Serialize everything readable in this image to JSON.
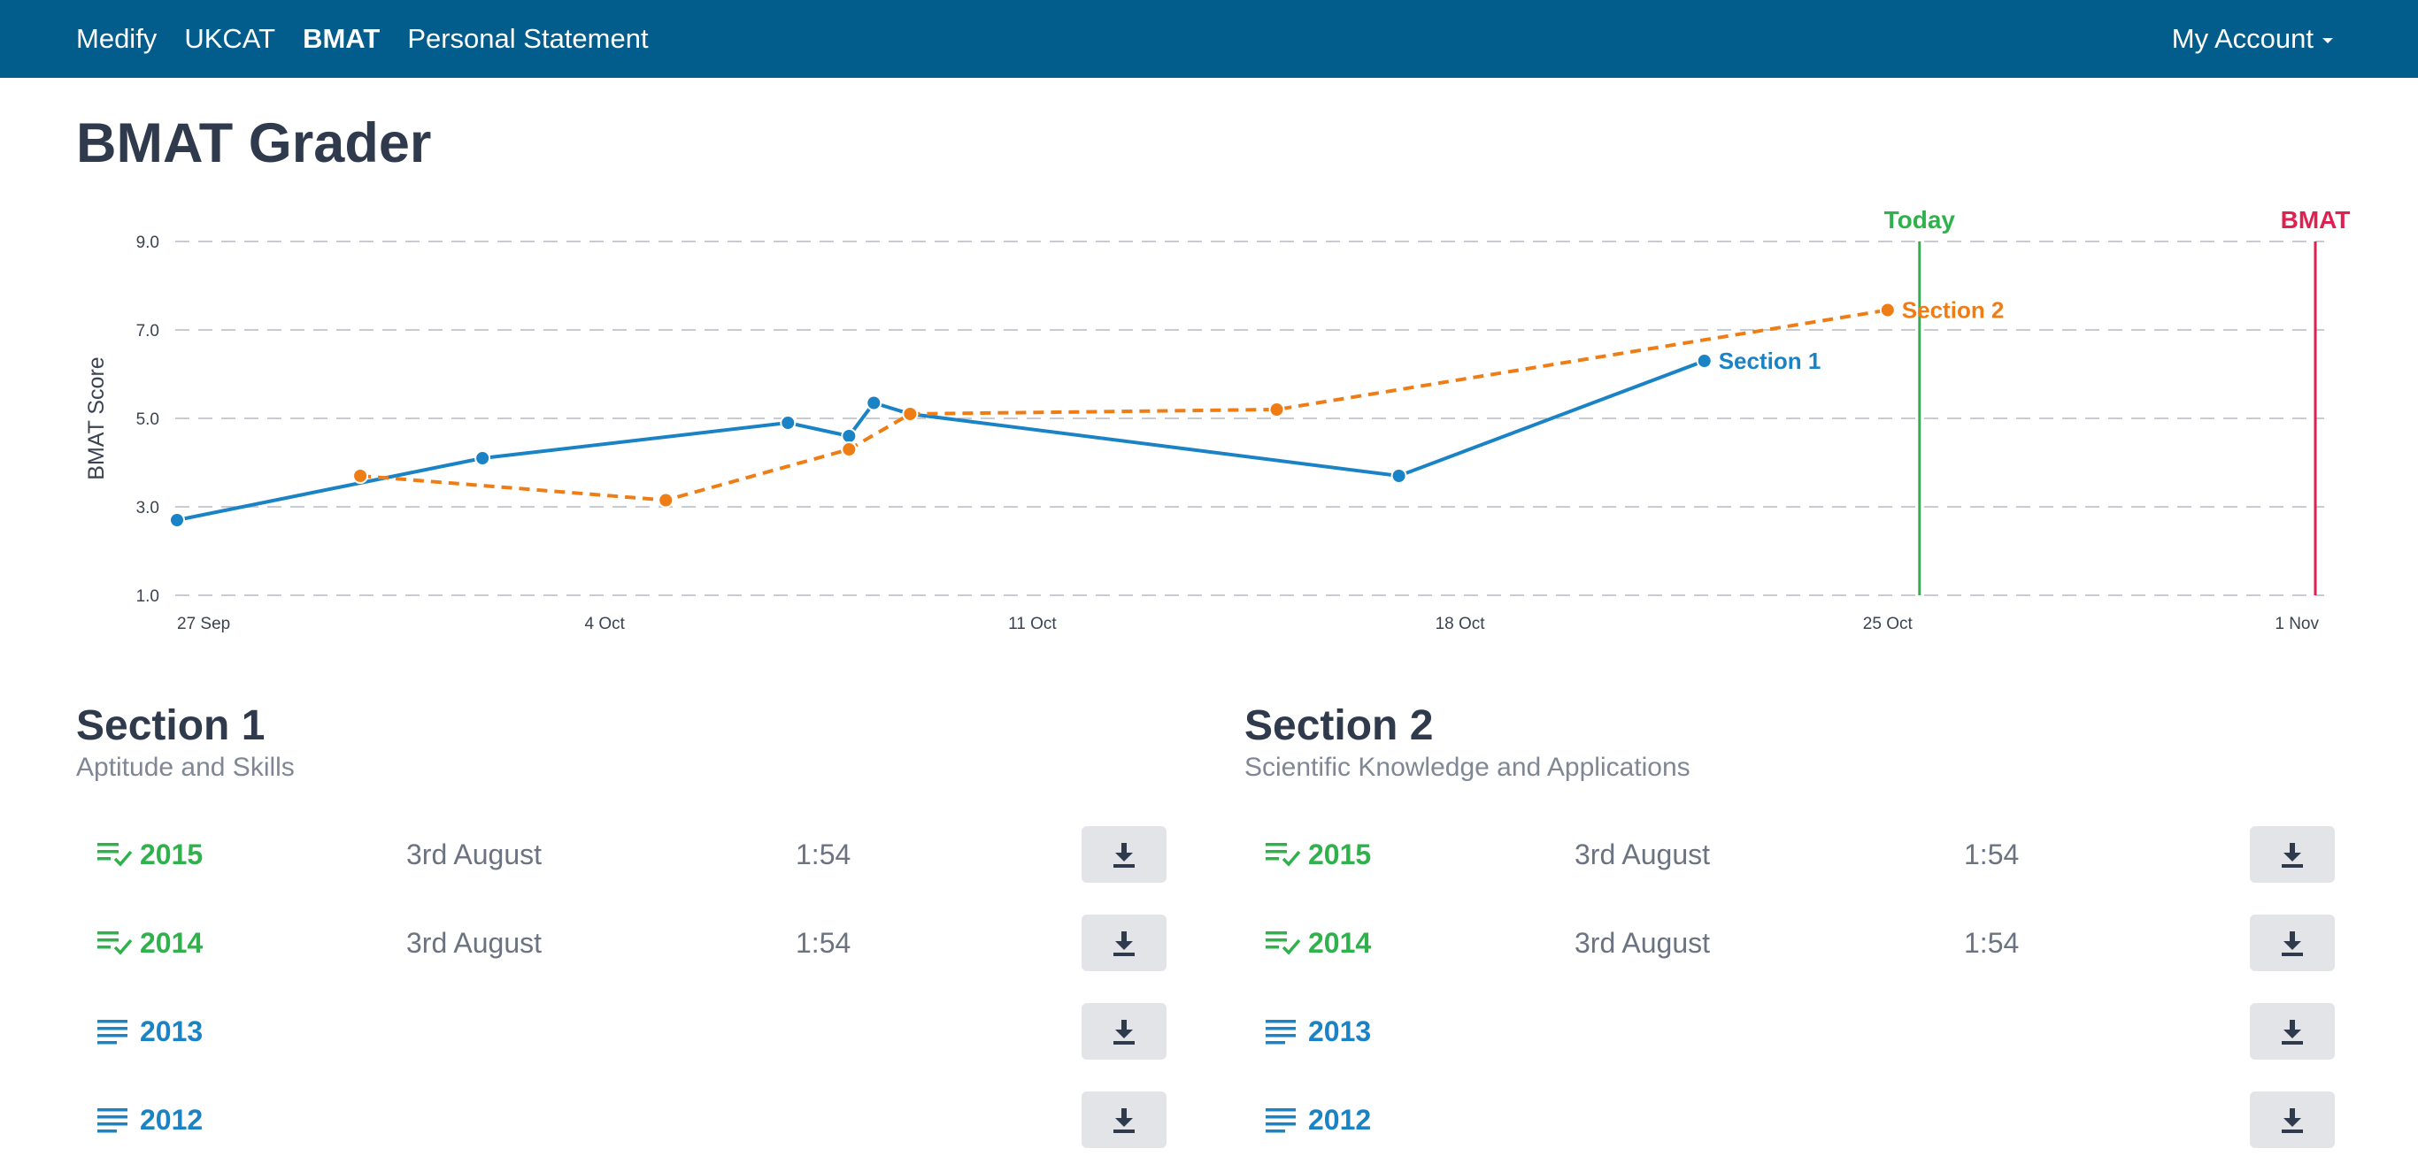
{
  "navbar": {
    "brand": "Medify",
    "links": [
      {
        "label": "UKCAT",
        "active": false
      },
      {
        "label": "BMAT",
        "active": true
      },
      {
        "label": "Personal Statement",
        "active": false
      }
    ],
    "account_label": "My Account"
  },
  "page": {
    "title": "BMAT Grader"
  },
  "chart_data": {
    "type": "line",
    "ylabel": "BMAT Score",
    "xlabel": "",
    "ylim": [
      1.0,
      9.0
    ],
    "yticks": [
      "1.0",
      "3.0",
      "5.0",
      "7.0",
      "9.0"
    ],
    "xlim": [
      "2015-09-27",
      "2015-11-01"
    ],
    "xticks": [
      {
        "date": "2015-09-27",
        "label": "27 Sep"
      },
      {
        "date": "2015-10-04",
        "label": "4 Oct"
      },
      {
        "date": "2015-10-11",
        "label": "11 Oct"
      },
      {
        "date": "2015-10-18",
        "label": "18 Oct"
      },
      {
        "date": "2015-10-25",
        "label": "25 Oct"
      },
      {
        "date": "2015-11-01",
        "label": "1 Nov"
      }
    ],
    "grid": true,
    "markers": [
      {
        "label": "Today",
        "date": "2015-10-25",
        "color": "#2fb24c"
      },
      {
        "label": "BMAT",
        "date": "2015-11-01",
        "color": "#e0204f"
      }
    ],
    "series": [
      {
        "name": "Section 1",
        "color": "#1a83c6",
        "dashed": false,
        "points": [
          [
            "2015-09-27",
            2.7
          ],
          [
            "2015-10-02",
            4.1
          ],
          [
            "2015-10-07",
            4.9
          ],
          [
            "2015-10-08",
            4.6
          ],
          [
            "2015-10-08",
            5.35
          ],
          [
            "2015-10-09",
            5.1
          ],
          [
            "2015-10-17",
            3.7
          ],
          [
            "2015-10-22",
            6.3
          ]
        ]
      },
      {
        "name": "Section 2",
        "color": "#ef7d16",
        "dashed": true,
        "points": [
          [
            "2015-09-30",
            3.7
          ],
          [
            "2015-10-05",
            3.15
          ],
          [
            "2015-10-08",
            4.3
          ],
          [
            "2015-10-09",
            5.1
          ],
          [
            "2015-10-15",
            5.2
          ],
          [
            "2015-10-25",
            7.45
          ]
        ]
      }
    ]
  },
  "sections": [
    {
      "title": "Section 1",
      "subtitle": "Aptitude and Skills",
      "papers": [
        {
          "year": "2015",
          "date": "3rd August",
          "time": "1:54",
          "completed": true
        },
        {
          "year": "2014",
          "date": "3rd August",
          "time": "1:54",
          "completed": true
        },
        {
          "year": "2013",
          "date": "",
          "time": "",
          "completed": false
        },
        {
          "year": "2012",
          "date": "",
          "time": "",
          "completed": false
        }
      ]
    },
    {
      "title": "Section 2",
      "subtitle": "Scientific Knowledge and Applications",
      "papers": [
        {
          "year": "2015",
          "date": "3rd August",
          "time": "1:54",
          "completed": true
        },
        {
          "year": "2014",
          "date": "3rd August",
          "time": "1:54",
          "completed": true
        },
        {
          "year": "2013",
          "date": "",
          "time": "",
          "completed": false
        },
        {
          "year": "2012",
          "date": "",
          "time": "",
          "completed": false
        }
      ]
    }
  ],
  "icons": {
    "completed": "list-check-icon",
    "pending": "list-icon",
    "download": "download-icon",
    "caret": "caret-down-icon"
  },
  "colors": {
    "navbar": "#025d8d",
    "completed": "#2fb24c",
    "pending": "#1a83c6"
  }
}
